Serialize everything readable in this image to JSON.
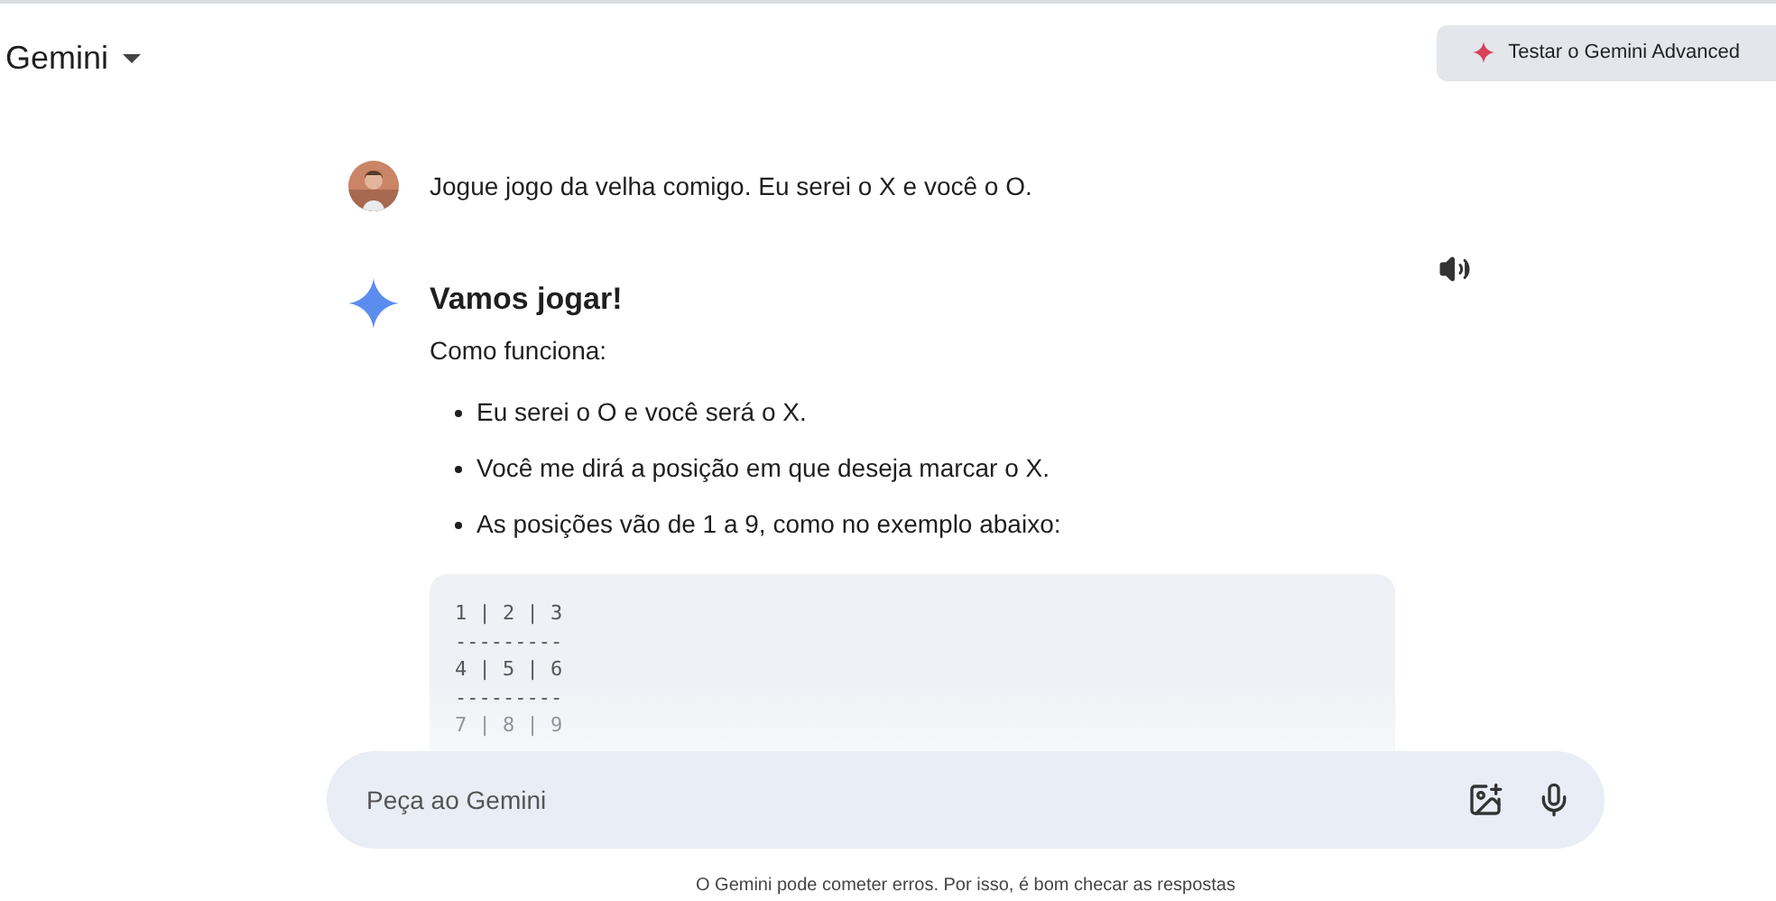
{
  "header": {
    "title": "Gemini",
    "upgrade_button": "Testar o Gemini Advanced"
  },
  "user_message": {
    "text": "Jogue jogo da velha comigo. Eu serei o X e você o O."
  },
  "response": {
    "heading": "Vamos jogar!",
    "subheading": "Como funciona:",
    "bullets": [
      "Eu serei o O e você será o X.",
      "Você me dirá a posição em que deseja marcar o X.",
      "As posições vão de 1 a 9, como no exemplo abaixo:"
    ],
    "code_lines": [
      "1 | 2 | 3",
      "---------",
      "4 | 5 | 6",
      "---------",
      "7 | 8 | 9"
    ]
  },
  "input": {
    "placeholder": "Peça ao Gemini"
  },
  "footer": "O Gemini pode cometer erros. Por isso, é bom checar as respostas"
}
